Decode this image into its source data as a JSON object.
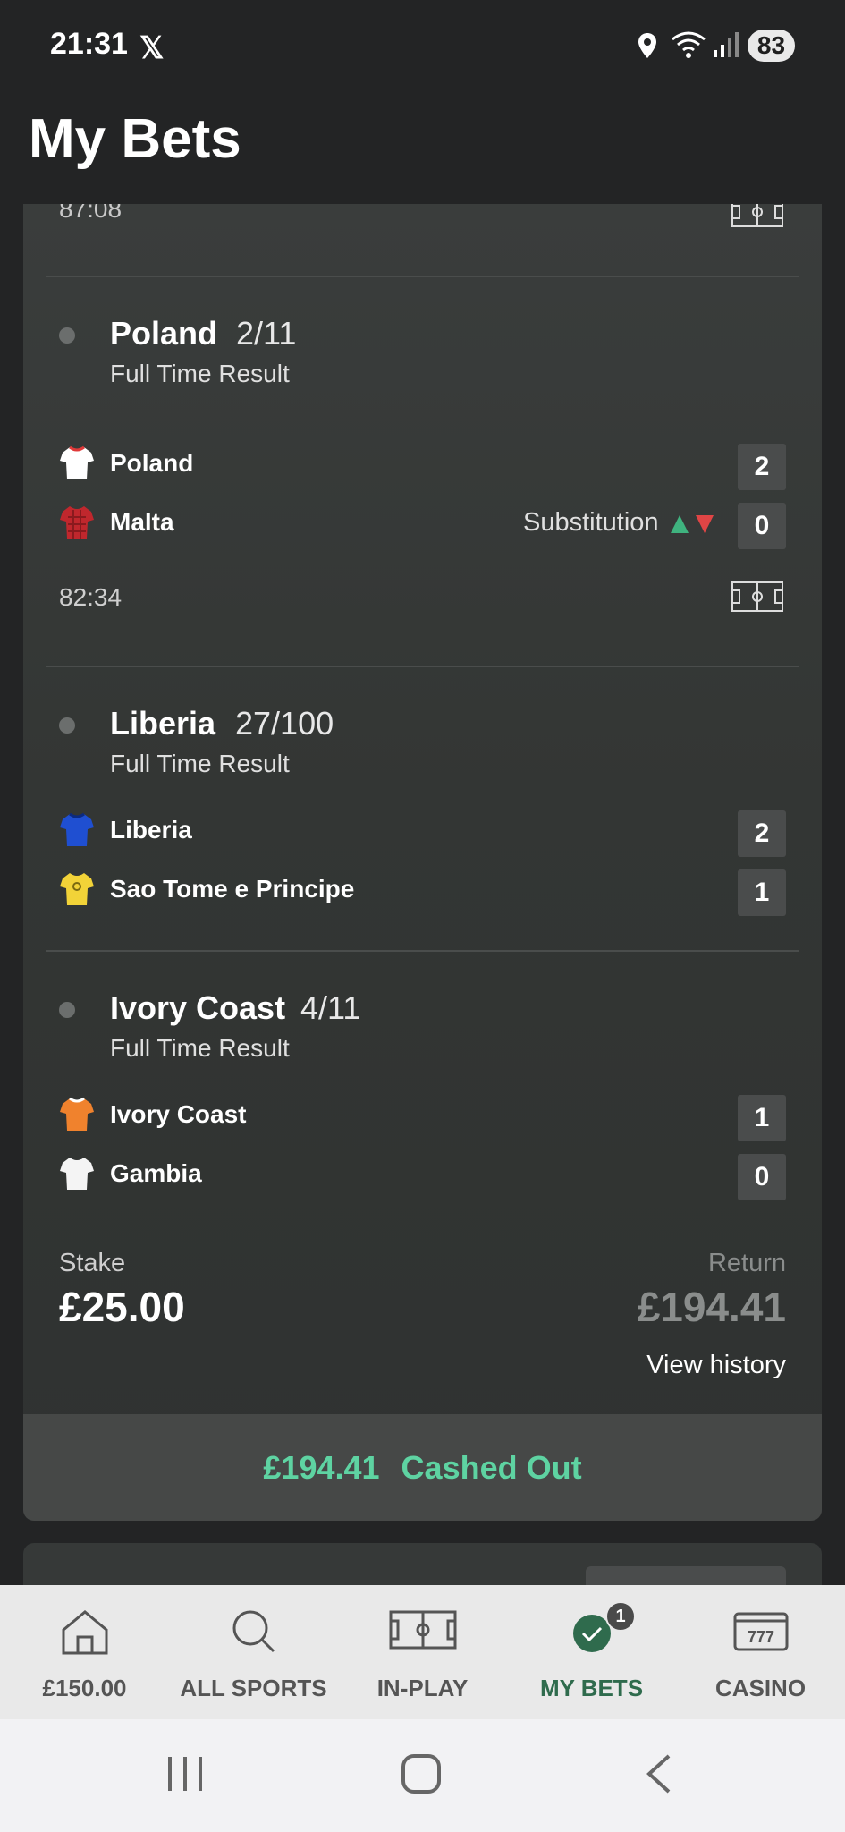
{
  "status": {
    "time": "21:31",
    "battery": "83"
  },
  "header": {
    "title": "My Bets"
  },
  "prev_leg": {
    "clock": "87:08"
  },
  "legs": [
    {
      "selection": "Poland",
      "odds": "2/11",
      "market": "Full Time Result",
      "teams": [
        {
          "name": "Poland",
          "score": "2",
          "shirt_color": "#ffffff",
          "accent": "#e03a3a"
        },
        {
          "name": "Malta",
          "score": "0",
          "shirt_color": "#c0272d",
          "event": "Substitution"
        }
      ],
      "clock": "82:34"
    },
    {
      "selection": "Liberia",
      "odds": "27/100",
      "market": "Full Time Result",
      "teams": [
        {
          "name": "Liberia",
          "score": "2",
          "shirt_color": "#1f4fd1"
        },
        {
          "name": "Sao Tome e Principe",
          "score": "1",
          "shirt_color": "#f2d338"
        }
      ]
    },
    {
      "selection": "Ivory Coast",
      "odds": "4/11",
      "market": "Full Time Result",
      "teams": [
        {
          "name": "Ivory Coast",
          "score": "1",
          "shirt_color": "#f0822d"
        },
        {
          "name": "Gambia",
          "score": "0",
          "shirt_color": "#f4f4f4"
        }
      ]
    }
  ],
  "bet_summary": {
    "stake_label": "Stake",
    "stake": "£25.00",
    "return_label": "Return",
    "return": "£194.41",
    "view_history": "View history",
    "cashout_amount": "£194.41",
    "cashout_label": "Cashed Out"
  },
  "bottom_nav": [
    {
      "label": "£150.00",
      "icon": "home-icon"
    },
    {
      "label": "ALL SPORTS",
      "icon": "search-icon"
    },
    {
      "label": "IN-PLAY",
      "icon": "pitch-icon"
    },
    {
      "label": "MY BETS",
      "icon": "check-circle-icon",
      "badge": "1",
      "active": true
    },
    {
      "label": "CASINO",
      "icon": "slot-machine-icon"
    }
  ],
  "colors": {
    "accent_green": "#5ed3a2",
    "active_nav": "#2f6b4d"
  }
}
